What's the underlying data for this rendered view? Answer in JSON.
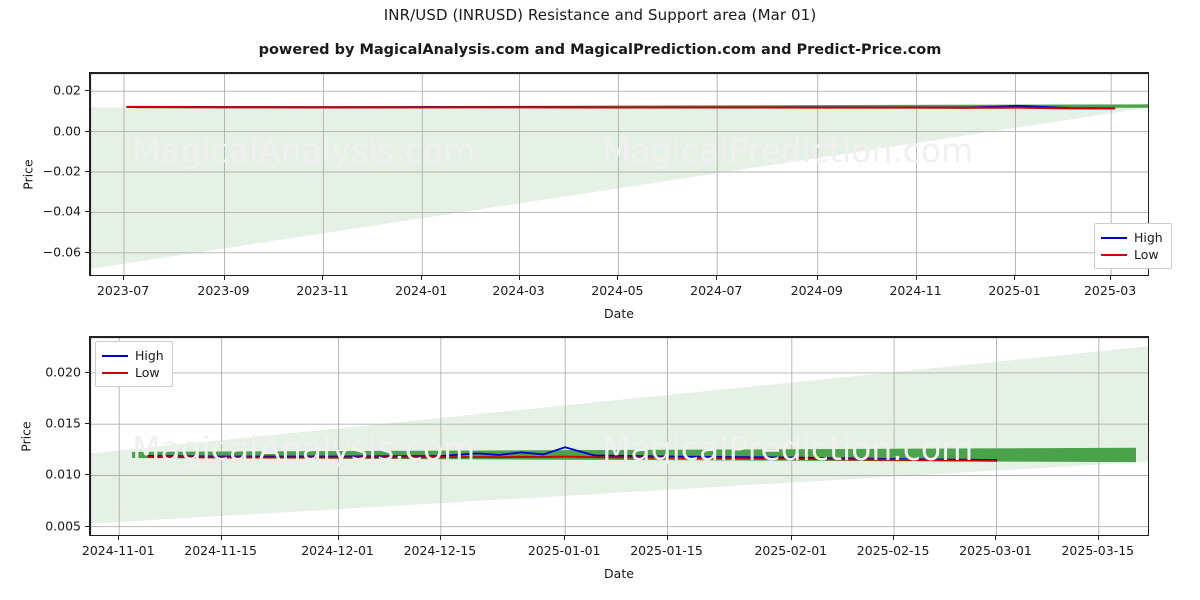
{
  "header": {
    "title": "INR/USD (INRUSD) Resistance and Support area (Mar 01)",
    "subtitle": "powered by MagicalAnalysis.com and MagicalPrediction.com and Predict-Price.com"
  },
  "watermarks": {
    "analysis": "MagicalAnalysis.com",
    "prediction": "MagicalPrediction.com"
  },
  "colors": {
    "high_line": "#0000cc",
    "low_line": "#cc0000",
    "band_solid": "#4aa24a",
    "band_light": "#e6f1e6",
    "axis": "#222222",
    "grid": "#b0b0b0",
    "watermark": "#f0f0f0"
  },
  "chart_data": [
    {
      "id": "top-chart",
      "type": "line",
      "title": "INR/USD (INRUSD) Resistance and Support area (Mar 01)",
      "xlabel": "Date",
      "ylabel": "Price",
      "grid": true,
      "legend_position": "lower right",
      "xlim": [
        "2023-06-10",
        "2025-03-25"
      ],
      "ylim": [
        -0.072,
        0.029
      ],
      "yticks": [
        0.02,
        0.0,
        -0.02,
        -0.04,
        -0.06
      ],
      "ytick_labels": [
        "0.02",
        "0.00",
        "−0.02",
        "−0.04",
        "−0.06"
      ],
      "xticks": [
        "2023-07",
        "2023-09",
        "2023-11",
        "2024-01",
        "2024-03",
        "2024-05",
        "2024-07",
        "2024-09",
        "2024-11",
        "2025-01",
        "2025-03"
      ],
      "series": [
        {
          "name": "High",
          "color": "#0000cc",
          "x": [
            "2023-07-03",
            "2023-09-01",
            "2023-11-01",
            "2024-01-02",
            "2024-03-01",
            "2024-05-01",
            "2024-07-01",
            "2024-09-02",
            "2024-11-01",
            "2024-12-02",
            "2024-12-20",
            "2025-01-02",
            "2025-02-03",
            "2025-03-03"
          ],
          "values": [
            0.01225,
            0.01212,
            0.01205,
            0.01208,
            0.01212,
            0.012,
            0.01198,
            0.01196,
            0.01192,
            0.01188,
            0.01225,
            0.0127,
            0.0116,
            0.0115
          ]
        },
        {
          "name": "Low",
          "color": "#cc0000",
          "x": [
            "2023-07-03",
            "2023-09-01",
            "2023-11-01",
            "2024-01-02",
            "2024-03-01",
            "2024-05-01",
            "2024-07-01",
            "2024-09-02",
            "2024-11-01",
            "2024-12-02",
            "2024-12-20",
            "2025-01-02",
            "2025-02-03",
            "2025-03-03"
          ],
          "values": [
            0.01218,
            0.01205,
            0.01198,
            0.012,
            0.01205,
            0.01192,
            0.0119,
            0.01188,
            0.01184,
            0.0118,
            0.01182,
            0.01185,
            0.0115,
            0.01142
          ]
        }
      ],
      "bands": [
        {
          "name": "support-area-light",
          "color": "#e6f1e6",
          "description": "wide pale-green wedge narrowing from left to right",
          "upper": [
            0.012,
            0.0128
          ],
          "lower": [
            -0.068,
            0.012
          ]
        },
        {
          "name": "resistance-area-solid",
          "color": "#4aa24a",
          "description": "thin solid green band along the price lines, thicker at right forecast segment",
          "upper": [
            0.0123,
            0.0135
          ],
          "lower": [
            0.0115,
            0.0118
          ]
        }
      ]
    },
    {
      "id": "bottom-chart",
      "type": "line",
      "title": "",
      "xlabel": "Date",
      "ylabel": "Price",
      "grid": true,
      "legend_position": "upper left",
      "xlim": [
        "2024-10-28",
        "2025-03-22"
      ],
      "ylim": [
        0.004,
        0.0235
      ],
      "yticks": [
        0.02,
        0.015,
        0.01,
        0.005
      ],
      "ytick_labels": [
        "0.020",
        "0.015",
        "0.010",
        "0.005"
      ],
      "xticks": [
        "2024-11-01",
        "2024-11-15",
        "2024-12-01",
        "2024-12-15",
        "2025-01-01",
        "2025-01-15",
        "2025-02-01",
        "2025-02-15",
        "2025-03-01",
        "2025-03-15"
      ],
      "series": [
        {
          "name": "High",
          "color": "#0000cc",
          "x": [
            "2024-11-05",
            "2024-11-15",
            "2024-12-01",
            "2024-12-15",
            "2024-12-20",
            "2024-12-23",
            "2024-12-26",
            "2024-12-29",
            "2025-01-01",
            "2025-01-05",
            "2025-01-15",
            "2025-02-01",
            "2025-02-10",
            "2025-02-15",
            "2025-03-01"
          ],
          "values": [
            0.0119,
            0.01185,
            0.01185,
            0.0119,
            0.01215,
            0.012,
            0.01225,
            0.01205,
            0.01275,
            0.01195,
            0.01185,
            0.01175,
            0.01165,
            0.0116,
            0.0115
          ]
        },
        {
          "name": "Low",
          "color": "#cc0000",
          "x": [
            "2024-11-05",
            "2024-11-15",
            "2024-12-01",
            "2024-12-15",
            "2024-12-20",
            "2024-12-23",
            "2024-12-26",
            "2024-12-29",
            "2025-01-01",
            "2025-01-05",
            "2025-01-15",
            "2025-02-01",
            "2025-02-10",
            "2025-02-15",
            "2025-03-01"
          ],
          "values": [
            0.0118,
            0.01175,
            0.01175,
            0.01178,
            0.0118,
            0.01178,
            0.01182,
            0.0118,
            0.01185,
            0.01178,
            0.01172,
            0.01162,
            0.01155,
            0.01152,
            0.01142
          ]
        }
      ],
      "bands": [
        {
          "name": "support-area-light",
          "color": "#e6f1e6",
          "description": "pale-green wedge whose upper edge rises from left to right",
          "upper": [
            0.01215,
            0.0226
          ],
          "lower": [
            0.0053,
            0.01135
          ]
        },
        {
          "name": "resistance-area-solid",
          "color": "#4aa24a",
          "description": "solid green horizontal band just above the price lines",
          "upper": [
            0.0123,
            0.0127
          ],
          "lower": [
            0.0117,
            0.0113
          ]
        }
      ]
    }
  ],
  "legend": {
    "items": [
      {
        "label": "High",
        "color": "#0000cc"
      },
      {
        "label": "Low",
        "color": "#cc0000"
      }
    ]
  }
}
